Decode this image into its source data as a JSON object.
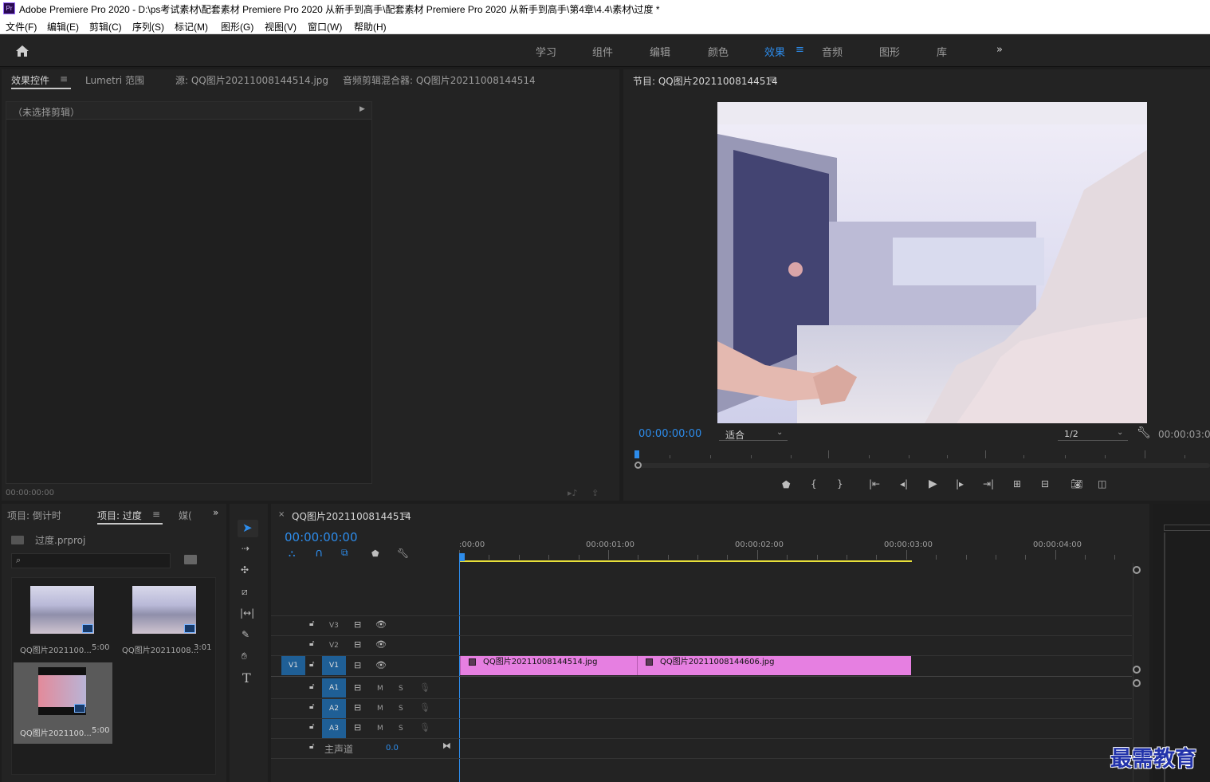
{
  "window": {
    "title": "Adobe Premiere Pro 2020 - D:\\ps考试素材\\配套素材 Premiere Pro 2020 从新手到高手\\配套素材 Premiere Pro 2020 从新手到高手\\第4章\\4.4\\素材\\过度 *",
    "app_icon": "Pr"
  },
  "menu": [
    "文件(F)",
    "编辑(E)",
    "剪辑(C)",
    "序列(S)",
    "标记(M)",
    "图形(G)",
    "视图(V)",
    "窗口(W)",
    "帮助(H)"
  ],
  "workspaces": [
    "学习",
    "组件",
    "编辑",
    "颜色",
    "效果",
    "音频",
    "图形",
    "库"
  ],
  "workspace_active": "效果",
  "source_panel": {
    "tabs": [
      "效果控件",
      "Lumetri 范围",
      "源: QQ图片20211008144514.jpg",
      "音频剪辑混合器: QQ图片20211008144514"
    ],
    "no_clip": "（未选择剪辑）",
    "timecode": "00:00:00:00"
  },
  "program_monitor": {
    "title": "节目: QQ图片20211008144514",
    "timecode": "00:00:00:00",
    "fit": "适合",
    "resolution": "1/2",
    "end_timecode": "00:00:03:0"
  },
  "project_panel": {
    "tabs": [
      "项目: 倒计时",
      "项目: 过度",
      "媒("
    ],
    "file": "过度.prproj",
    "search_placeholder": "",
    "items": [
      {
        "name": "QQ图片2021100...",
        "duration": "5:00"
      },
      {
        "name": "QQ图片20211008...",
        "duration": "3:01"
      },
      {
        "name": "QQ图片2021100...",
        "duration": "5:00"
      }
    ]
  },
  "timeline": {
    "sequence": "QQ图片20211008144514",
    "timecode": "00:00:00:00",
    "ruler": [
      ":00:00",
      "00:00:01:00",
      "00:00:02:00",
      "00:00:03:00",
      "00:00:04:00"
    ],
    "video_tracks": [
      "V3",
      "V2",
      "V1"
    ],
    "audio_tracks": [
      "A1",
      "A2",
      "A3"
    ],
    "source_v": "V1",
    "mute": "M",
    "solo": "S",
    "master": "主声道",
    "master_value": "0.0",
    "clips": [
      "QQ图片20211008144514.jpg",
      "QQ图片20211008144606.jpg"
    ]
  },
  "watermark": "最需教育"
}
